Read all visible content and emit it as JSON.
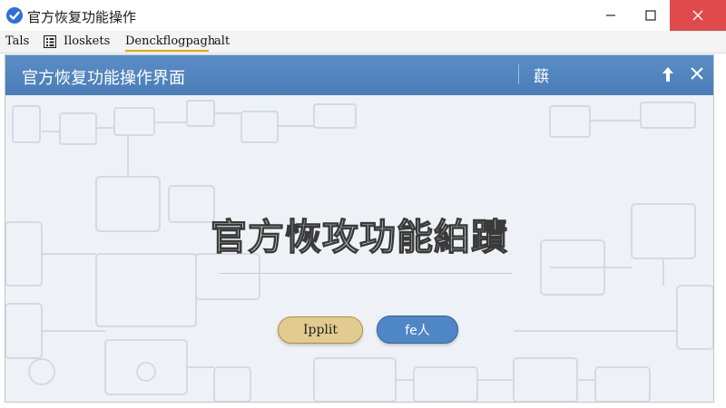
{
  "window": {
    "title": "官方恢复功能操作",
    "app_icon": "checkmark-shield-icon",
    "controls": [
      "minimize-icon",
      "maximize-icon",
      "close-icon"
    ]
  },
  "menubar": {
    "items": [
      {
        "label": "Tals"
      },
      {
        "label": "Iloskets",
        "icon": "list-icon"
      },
      {
        "label": "Denckflogpagh"
      },
      {
        "label": "alt"
      }
    ]
  },
  "dialog": {
    "title": "官方恢复功能操作界面",
    "header_glyph": "蕻",
    "header_icons": [
      "up-arrow-icon",
      "close-icon"
    ],
    "heading": "官方恢攻功能絈蹟",
    "buttons": {
      "primary": "Ipplit",
      "secondary": "fe人"
    }
  },
  "colors": {
    "header_blue": "#4a7db8",
    "close_red": "#e14a4a",
    "primary_button": "#e2cb90",
    "secondary_button": "#4f86c6",
    "menu_underline": "#e0a600"
  }
}
